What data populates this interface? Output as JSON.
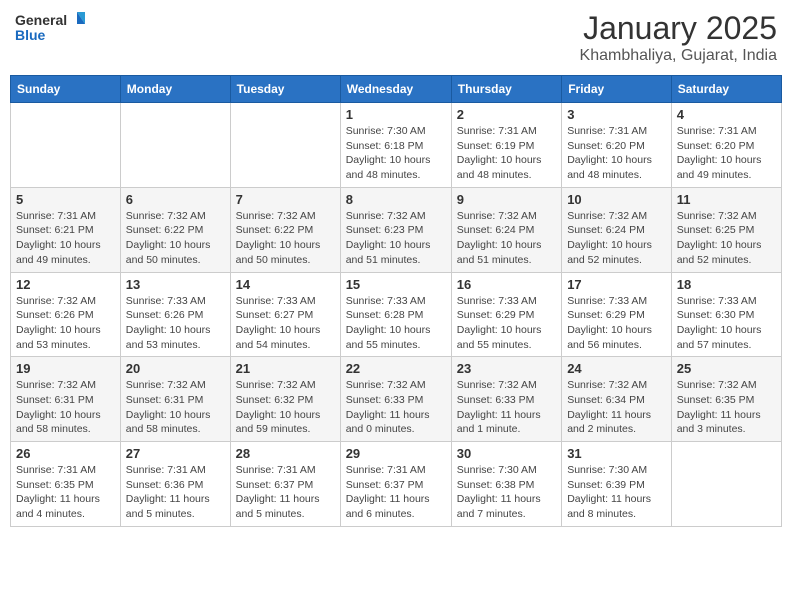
{
  "header": {
    "logo_general": "General",
    "logo_blue": "Blue",
    "month": "January 2025",
    "location": "Khambhaliya, Gujarat, India"
  },
  "weekdays": [
    "Sunday",
    "Monday",
    "Tuesday",
    "Wednesday",
    "Thursday",
    "Friday",
    "Saturday"
  ],
  "weeks": [
    [
      {
        "date": "",
        "info": ""
      },
      {
        "date": "",
        "info": ""
      },
      {
        "date": "",
        "info": ""
      },
      {
        "date": "1",
        "info": "Sunrise: 7:30 AM\nSunset: 6:18 PM\nDaylight: 10 hours\nand 48 minutes."
      },
      {
        "date": "2",
        "info": "Sunrise: 7:31 AM\nSunset: 6:19 PM\nDaylight: 10 hours\nand 48 minutes."
      },
      {
        "date": "3",
        "info": "Sunrise: 7:31 AM\nSunset: 6:20 PM\nDaylight: 10 hours\nand 48 minutes."
      },
      {
        "date": "4",
        "info": "Sunrise: 7:31 AM\nSunset: 6:20 PM\nDaylight: 10 hours\nand 49 minutes."
      }
    ],
    [
      {
        "date": "5",
        "info": "Sunrise: 7:31 AM\nSunset: 6:21 PM\nDaylight: 10 hours\nand 49 minutes."
      },
      {
        "date": "6",
        "info": "Sunrise: 7:32 AM\nSunset: 6:22 PM\nDaylight: 10 hours\nand 50 minutes."
      },
      {
        "date": "7",
        "info": "Sunrise: 7:32 AM\nSunset: 6:22 PM\nDaylight: 10 hours\nand 50 minutes."
      },
      {
        "date": "8",
        "info": "Sunrise: 7:32 AM\nSunset: 6:23 PM\nDaylight: 10 hours\nand 51 minutes."
      },
      {
        "date": "9",
        "info": "Sunrise: 7:32 AM\nSunset: 6:24 PM\nDaylight: 10 hours\nand 51 minutes."
      },
      {
        "date": "10",
        "info": "Sunrise: 7:32 AM\nSunset: 6:24 PM\nDaylight: 10 hours\nand 52 minutes."
      },
      {
        "date": "11",
        "info": "Sunrise: 7:32 AM\nSunset: 6:25 PM\nDaylight: 10 hours\nand 52 minutes."
      }
    ],
    [
      {
        "date": "12",
        "info": "Sunrise: 7:32 AM\nSunset: 6:26 PM\nDaylight: 10 hours\nand 53 minutes."
      },
      {
        "date": "13",
        "info": "Sunrise: 7:33 AM\nSunset: 6:26 PM\nDaylight: 10 hours\nand 53 minutes."
      },
      {
        "date": "14",
        "info": "Sunrise: 7:33 AM\nSunset: 6:27 PM\nDaylight: 10 hours\nand 54 minutes."
      },
      {
        "date": "15",
        "info": "Sunrise: 7:33 AM\nSunset: 6:28 PM\nDaylight: 10 hours\nand 55 minutes."
      },
      {
        "date": "16",
        "info": "Sunrise: 7:33 AM\nSunset: 6:29 PM\nDaylight: 10 hours\nand 55 minutes."
      },
      {
        "date": "17",
        "info": "Sunrise: 7:33 AM\nSunset: 6:29 PM\nDaylight: 10 hours\nand 56 minutes."
      },
      {
        "date": "18",
        "info": "Sunrise: 7:33 AM\nSunset: 6:30 PM\nDaylight: 10 hours\nand 57 minutes."
      }
    ],
    [
      {
        "date": "19",
        "info": "Sunrise: 7:32 AM\nSunset: 6:31 PM\nDaylight: 10 hours\nand 58 minutes."
      },
      {
        "date": "20",
        "info": "Sunrise: 7:32 AM\nSunset: 6:31 PM\nDaylight: 10 hours\nand 58 minutes."
      },
      {
        "date": "21",
        "info": "Sunrise: 7:32 AM\nSunset: 6:32 PM\nDaylight: 10 hours\nand 59 minutes."
      },
      {
        "date": "22",
        "info": "Sunrise: 7:32 AM\nSunset: 6:33 PM\nDaylight: 11 hours\nand 0 minutes."
      },
      {
        "date": "23",
        "info": "Sunrise: 7:32 AM\nSunset: 6:33 PM\nDaylight: 11 hours\nand 1 minute."
      },
      {
        "date": "24",
        "info": "Sunrise: 7:32 AM\nSunset: 6:34 PM\nDaylight: 11 hours\nand 2 minutes."
      },
      {
        "date": "25",
        "info": "Sunrise: 7:32 AM\nSunset: 6:35 PM\nDaylight: 11 hours\nand 3 minutes."
      }
    ],
    [
      {
        "date": "26",
        "info": "Sunrise: 7:31 AM\nSunset: 6:35 PM\nDaylight: 11 hours\nand 4 minutes."
      },
      {
        "date": "27",
        "info": "Sunrise: 7:31 AM\nSunset: 6:36 PM\nDaylight: 11 hours\nand 5 minutes."
      },
      {
        "date": "28",
        "info": "Sunrise: 7:31 AM\nSunset: 6:37 PM\nDaylight: 11 hours\nand 5 minutes."
      },
      {
        "date": "29",
        "info": "Sunrise: 7:31 AM\nSunset: 6:37 PM\nDaylight: 11 hours\nand 6 minutes."
      },
      {
        "date": "30",
        "info": "Sunrise: 7:30 AM\nSunset: 6:38 PM\nDaylight: 11 hours\nand 7 minutes."
      },
      {
        "date": "31",
        "info": "Sunrise: 7:30 AM\nSunset: 6:39 PM\nDaylight: 11 hours\nand 8 minutes."
      },
      {
        "date": "",
        "info": ""
      }
    ]
  ]
}
